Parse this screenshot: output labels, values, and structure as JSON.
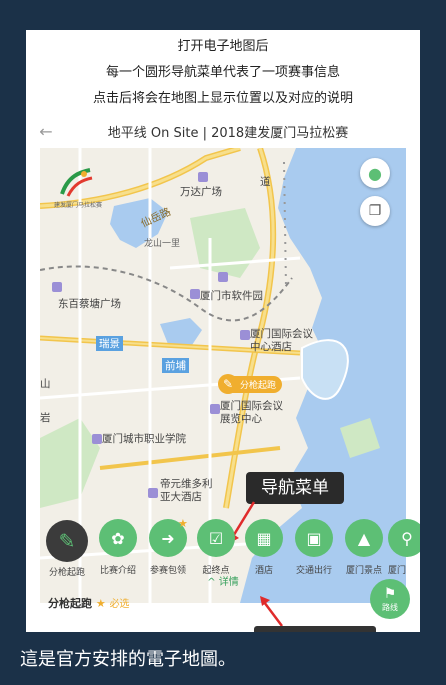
{
  "instructions": [
    "打开电子地图后",
    "每一个圆形导航菜单代表了一项赛事信息",
    "点击后将会在地图上显示位置以及对应的说明"
  ],
  "header": {
    "back": "←",
    "title": "地平线 On Site | 2018建发厦门马拉松赛"
  },
  "map_labels": {
    "wanda": "万达广场",
    "longshan": "龙山一里",
    "dongbai": "东百蔡塘广场",
    "software": "厦门市软件园",
    "ruijing": "瑞景",
    "qianpu": "前埔",
    "intl_conf": "厦门国际会议中心酒店",
    "intl_exh": "厦门国际会议展览中心",
    "college": "厦门城市职业学院",
    "hotel": "帝元维多利亚大酒店",
    "mountain": "山",
    "yan": "岩",
    "xiandao": "仙岳路",
    "daoyuan": "道",
    "logo": "建发厦门马拉松赛"
  },
  "start_marker": "分枪起跑",
  "callout": "导航菜单",
  "nav": [
    {
      "label": "分枪起跑",
      "icon": "pencil-icon"
    },
    {
      "label": "比赛介绍",
      "icon": "grid-icon"
    },
    {
      "label": "参赛包领",
      "icon": "arrow-icon"
    },
    {
      "label": "起终点",
      "icon": "calendar-icon"
    },
    {
      "label": "酒店",
      "icon": "building-icon"
    },
    {
      "label": "交通出行",
      "icon": "bus-icon"
    },
    {
      "label": "厦门景点",
      "icon": "landscape-icon"
    },
    {
      "label": "厦门",
      "icon": "fork-icon"
    }
  ],
  "detail": "^ 详情",
  "info": {
    "title": "分枪起跑",
    "required": "必选"
  },
  "route_button": "路线",
  "caption": "這是官方安排的電子地圖。",
  "colors": {
    "accent": "#5dbf75",
    "marker": "#f0ae2e",
    "sea": "#a9cbef",
    "background": "#1b3148"
  }
}
